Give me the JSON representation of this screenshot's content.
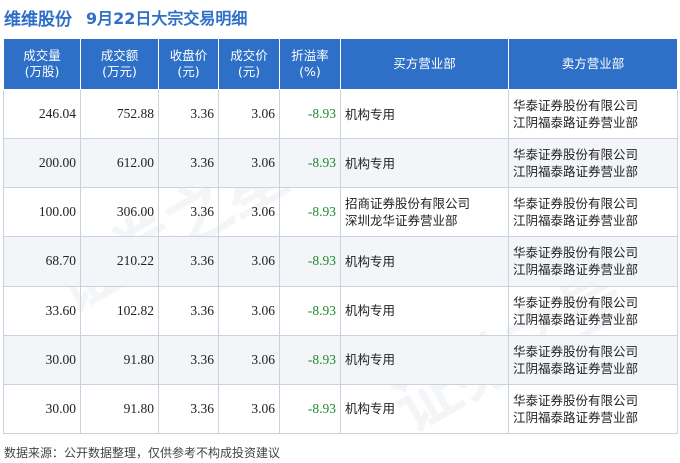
{
  "title": {
    "stock_name": "维维股份",
    "description": "9月22日大宗交易明细"
  },
  "columns": [
    {
      "line1": "成交量",
      "line2": "(万股)"
    },
    {
      "line1": "成交额",
      "line2": "(万元)"
    },
    {
      "line1": "收盘价",
      "line2": "(元)"
    },
    {
      "line1": "成交价",
      "line2": "(元)"
    },
    {
      "line1": "折溢率",
      "line2": "(%)"
    },
    {
      "line1": "买方营业部",
      "line2": ""
    },
    {
      "line1": "卖方营业部",
      "line2": ""
    }
  ],
  "rows": [
    {
      "volume": "246.04",
      "amount": "752.88",
      "close": "3.36",
      "price": "3.06",
      "premium": "-8.93",
      "buyer1": "机构专用",
      "buyer2": "",
      "seller1": "华泰证券股份有限公司",
      "seller2": "江阴福泰路证券营业部"
    },
    {
      "volume": "200.00",
      "amount": "612.00",
      "close": "3.36",
      "price": "3.06",
      "premium": "-8.93",
      "buyer1": "机构专用",
      "buyer2": "",
      "seller1": "华泰证券股份有限公司",
      "seller2": "江阴福泰路证券营业部"
    },
    {
      "volume": "100.00",
      "amount": "306.00",
      "close": "3.36",
      "price": "3.06",
      "premium": "-8.93",
      "buyer1": "招商证券股份有限公司",
      "buyer2": "深圳龙华证券营业部",
      "seller1": "华泰证券股份有限公司",
      "seller2": "江阴福泰路证券营业部"
    },
    {
      "volume": "68.70",
      "amount": "210.22",
      "close": "3.36",
      "price": "3.06",
      "premium": "-8.93",
      "buyer1": "机构专用",
      "buyer2": "",
      "seller1": "华泰证券股份有限公司",
      "seller2": "江阴福泰路证券营业部"
    },
    {
      "volume": "33.60",
      "amount": "102.82",
      "close": "3.36",
      "price": "3.06",
      "premium": "-8.93",
      "buyer1": "机构专用",
      "buyer2": "",
      "seller1": "华泰证券股份有限公司",
      "seller2": "江阴福泰路证券营业部"
    },
    {
      "volume": "30.00",
      "amount": "91.80",
      "close": "3.36",
      "price": "3.06",
      "premium": "-8.93",
      "buyer1": "机构专用",
      "buyer2": "",
      "seller1": "华泰证券股份有限公司",
      "seller2": "江阴福泰路证券营业部"
    },
    {
      "volume": "30.00",
      "amount": "91.80",
      "close": "3.36",
      "price": "3.06",
      "premium": "-8.93",
      "buyer1": "机构专用",
      "buyer2": "",
      "seller1": "华泰证券股份有限公司",
      "seller2": "江阴福泰路证券营业部"
    }
  ],
  "footer": "数据来源：公开数据整理，仅供参考不构成投资建议",
  "watermark": "证券之星",
  "colors": {
    "header_bg": "#2e6fc7",
    "title": "#2e6fc7",
    "negative": "#1f8a2d"
  }
}
